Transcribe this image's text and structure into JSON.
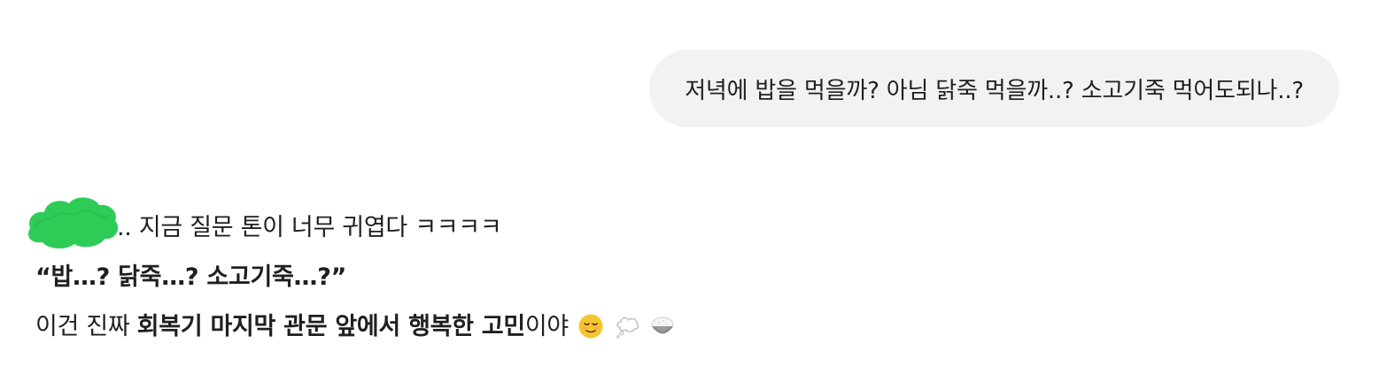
{
  "user_message": {
    "text": "저녁에 밥을 먹을까? 아님 닭죽 먹을까..? 소고기죽 먹어도되나..?"
  },
  "assistant_message": {
    "line1_text": ".. 지금 질문 톤이 너무 귀엽다 ㅋㅋㅋㅋ",
    "line2_quote": "“밥…? 닭죽…? 소고기죽…?”",
    "line3_prefix": "이건 진짜 ",
    "line3_bold": "회복기 마지막 관문 앞에서 행복한 고민",
    "line3_suffix": "이야",
    "emojis": [
      "relieved-face-icon",
      "thought-bubble-icon",
      "rice-bowl-icon"
    ]
  },
  "colors": {
    "user_bubble_bg": "#f2f2f2",
    "redaction": "#2ecc57",
    "text": "#1f1f1f"
  }
}
